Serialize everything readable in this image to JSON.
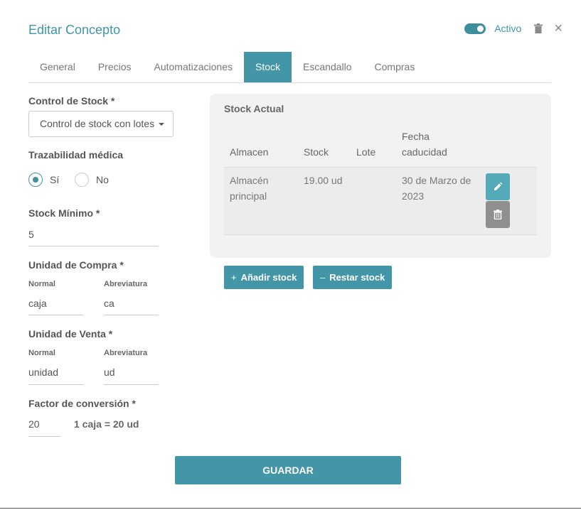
{
  "header": {
    "title": "Editar Concepto",
    "active_label": "Activo",
    "active_on": true
  },
  "tabs": [
    {
      "label": "General"
    },
    {
      "label": "Precios"
    },
    {
      "label": "Automatizaciones"
    },
    {
      "label": "Stock"
    },
    {
      "label": "Escandallo"
    },
    {
      "label": "Compras"
    }
  ],
  "active_tab": "Stock",
  "form": {
    "stock_control": {
      "label": "Control de Stock *",
      "value": "Control de stock con lotes"
    },
    "traceability": {
      "label": "Trazabilidad médica",
      "options": [
        "Sí",
        "No"
      ],
      "selected": "Sí"
    },
    "min_stock": {
      "label": "Stock Mínimo *",
      "value": "5"
    },
    "purchase_unit": {
      "label": "Unidad de Compra *",
      "normal_label": "Normal",
      "abbr_label": "Abreviatura",
      "normal_value": "caja",
      "abbr_value": "ca"
    },
    "sale_unit": {
      "label": "Unidad de Venta *",
      "normal_label": "Normal",
      "abbr_label": "Abreviatura",
      "normal_value": "unidad",
      "abbr_value": "ud"
    },
    "conversion": {
      "label": "Factor de conversión *",
      "value": "20",
      "hint": "1 caja = 20 ud"
    }
  },
  "stock_panel": {
    "title": "Stock Actual",
    "columns": [
      "Almacen",
      "Stock",
      "Lote",
      "Fecha caducidad"
    ],
    "rows": [
      {
        "warehouse": "Almacén principal",
        "stock": "19.00 ud",
        "lot": "",
        "expiry": "30 de Marzo de 2023"
      }
    ]
  },
  "buttons": {
    "add_stock": "Añadir stock",
    "add_prefix": "+",
    "remove_stock": "Restar stock",
    "remove_prefix": "–",
    "save": "GUARDAR"
  },
  "icons": {
    "trash": "trash-icon",
    "close": "close-icon",
    "edit": "pencil-icon"
  },
  "colors": {
    "accent": "#4396a7",
    "title": "#3f96a8",
    "delete_button": "#8f8f8f"
  }
}
